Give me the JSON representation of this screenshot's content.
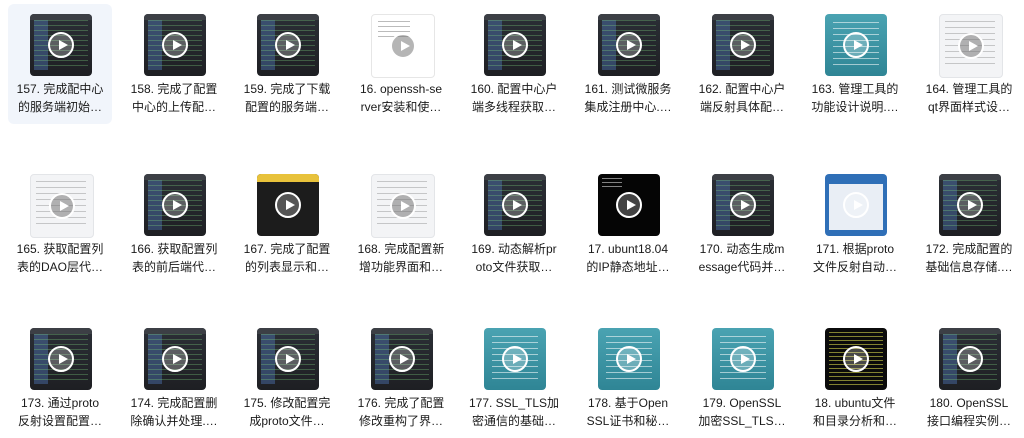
{
  "items": [
    {
      "line1": "157. 完成配中心",
      "line2": "的服务端初始…",
      "thumb": "dark-code",
      "icon": "play-icon",
      "selected": true
    },
    {
      "line1": "158. 完成了配置",
      "line2": "中心的上传配…",
      "thumb": "dark-code",
      "icon": "play-icon"
    },
    {
      "line1": "159. 完成了下载",
      "line2": "配置的服务端…",
      "thumb": "dark-code",
      "icon": "play-icon"
    },
    {
      "line1": "16. openssh-se",
      "line2": "rver安装和使…",
      "thumb": "white",
      "icon": "play-icon"
    },
    {
      "line1": "160. 配置中心户",
      "line2": "端多线程获取…",
      "thumb": "dark-code",
      "icon": "play-icon"
    },
    {
      "line1": "161. 测试微服务",
      "line2": "集成注册中心.…",
      "thumb": "dark-code",
      "icon": "play-icon"
    },
    {
      "line1": "162. 配置中心户",
      "line2": "端反射具体配…",
      "thumb": "dark-code",
      "icon": "play-icon"
    },
    {
      "line1": "163. 管理工具的",
      "line2": "功能设计说明.…",
      "thumb": "teal",
      "icon": "play-icon"
    },
    {
      "line1": "164. 管理工具的",
      "line2": "qt界面样式设…",
      "thumb": "light",
      "icon": "play-icon"
    },
    {
      "line1": "165. 获取配置列",
      "line2": "表的DAO层代…",
      "thumb": "light",
      "icon": "play-icon"
    },
    {
      "line1": "166. 获取配置列",
      "line2": "表的前后端代…",
      "thumb": "dark-code",
      "icon": "play-icon"
    },
    {
      "line1": "167. 完成了配置",
      "line2": "的列表显示和…",
      "thumb": "yellowbar",
      "icon": "play-icon"
    },
    {
      "line1": "168. 完成配置新",
      "line2": "增功能界面和…",
      "thumb": "light",
      "icon": "play-icon"
    },
    {
      "line1": "169. 动态解析pr",
      "line2": "oto文件获取…",
      "thumb": "dark-code",
      "icon": "play-icon"
    },
    {
      "line1": "17. ubunt18.04",
      "line2": "的IP静态地址…",
      "thumb": "black",
      "icon": "play-icon"
    },
    {
      "line1": "170. 动态生成m",
      "line2": "essage代码并…",
      "thumb": "dark-code",
      "icon": "play-icon"
    },
    {
      "line1": "171. 根据proto",
      "line2": "文件反射自动…",
      "thumb": "blueui",
      "icon": "play-icon"
    },
    {
      "line1": "172. 完成配置的",
      "line2": "基础信息存储.…",
      "thumb": "dark-code",
      "icon": "play-icon"
    },
    {
      "line1": "173. 通过proto",
      "line2": "反射设置配置…",
      "thumb": "dark-code",
      "icon": "play-icon"
    },
    {
      "line1": "174. 完成配置删",
      "line2": "除确认并处理.…",
      "thumb": "dark-code",
      "icon": "play-icon"
    },
    {
      "line1": "175. 修改配置完",
      "line2": "成proto文件…",
      "thumb": "dark-code",
      "icon": "play-icon"
    },
    {
      "line1": "176. 完成了配置",
      "line2": "修改重构了界…",
      "thumb": "dark-code",
      "icon": "play-icon"
    },
    {
      "line1": "177. SSL_TLS加",
      "line2": "密通信的基础…",
      "thumb": "teal",
      "icon": "play-icon"
    },
    {
      "line1": "178. 基于Open",
      "line2": "SSL证书和秘…",
      "thumb": "teal",
      "icon": "play-icon"
    },
    {
      "line1": "179. OpenSSL",
      "line2": "加密SSL_TLS…",
      "thumb": "teal",
      "icon": "play-icon"
    },
    {
      "line1": "18. ubuntu文件",
      "line2": "和目录分析和…",
      "thumb": "term",
      "icon": "play-icon"
    },
    {
      "line1": "180. OpenSSL",
      "line2": "接口编程实例…",
      "thumb": "dark-code",
      "icon": "play-icon"
    }
  ]
}
